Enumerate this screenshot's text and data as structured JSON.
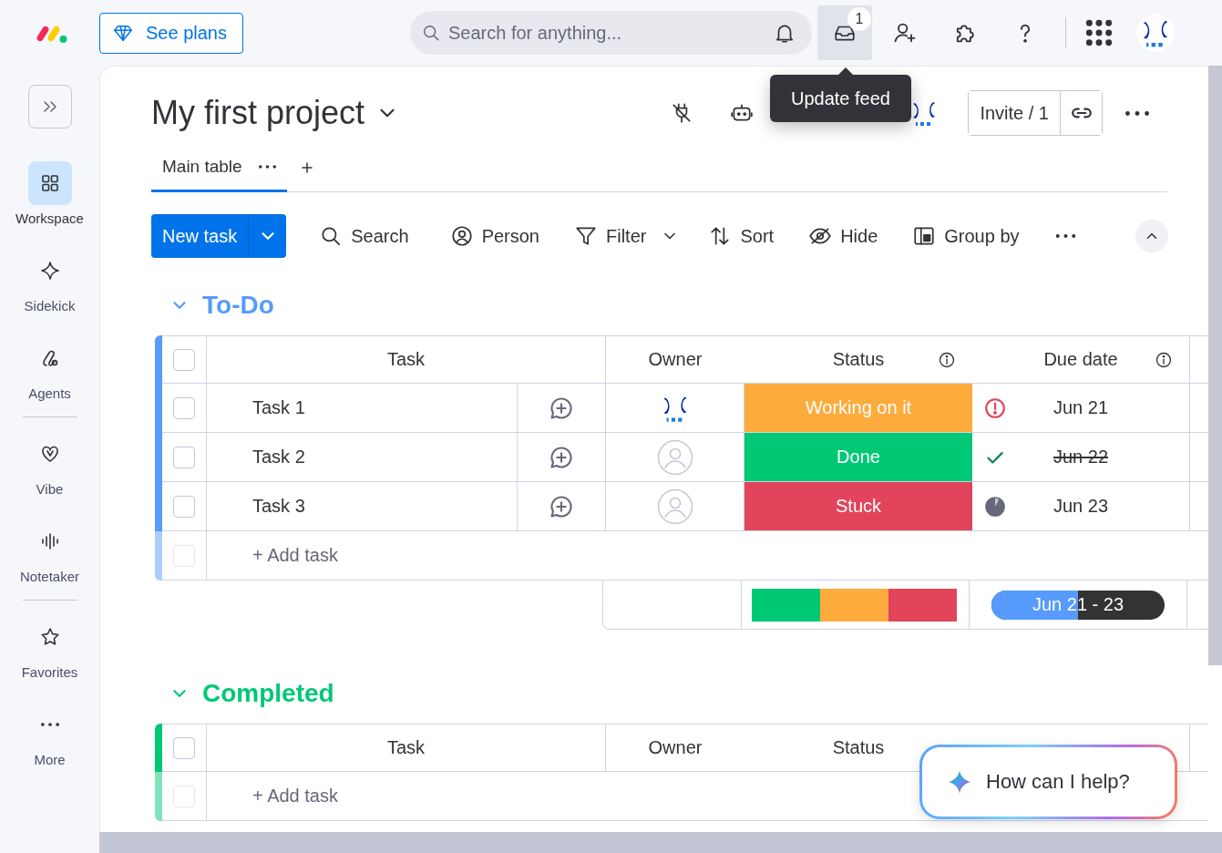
{
  "topbar": {
    "plans_button": "See plans",
    "search": {
      "placeholder": "Search for anything..."
    },
    "inbox_badge": "1"
  },
  "tooltip": "Update feed",
  "sidebar": {
    "sections": [
      {
        "items": [
          {
            "kind": "workspace",
            "label": "Workspace",
            "selected": true
          },
          {
            "kind": "sidekick",
            "label": "Sidekick",
            "selected": false
          },
          {
            "kind": "agents",
            "label": "Agents",
            "selected": false
          }
        ]
      },
      {
        "items": [
          {
            "kind": "vibe",
            "label": "Vibe",
            "selected": false
          },
          {
            "kind": "notetaker",
            "label": "Notetaker",
            "selected": false
          }
        ]
      },
      {
        "items": [
          {
            "kind": "favorites",
            "label": "Favorites",
            "selected": false
          },
          {
            "kind": "more",
            "label": "More",
            "selected": false
          }
        ]
      }
    ]
  },
  "board": {
    "title": "My first project",
    "invite": "Invite / 1",
    "tabs": [
      {
        "label": "Main table",
        "selected": true
      }
    ],
    "new_task": "New task",
    "toolbar": [
      {
        "kind": "search",
        "label": "Search"
      },
      {
        "kind": "person",
        "label": "Person"
      },
      {
        "kind": "filter",
        "label": "Filter"
      },
      {
        "kind": "sort",
        "label": "Sort"
      },
      {
        "kind": "hide",
        "label": "Hide"
      },
      {
        "kind": "group",
        "label": "Group by"
      }
    ],
    "groups": [
      {
        "name": "To-Do",
        "color": "#579bfc",
        "expanded": true,
        "all_checked": false,
        "columns": [
          {
            "label": "Task",
            "info": false
          },
          {
            "label": "Owner",
            "info": false
          },
          {
            "label": "Status",
            "info": true
          },
          {
            "label": "Due date",
            "info": true
          }
        ],
        "rows": [
          {
            "checked": false,
            "task": "Task 1",
            "assigned": true,
            "status": {
              "label": "Working on it",
              "color": "#fdab3d"
            },
            "due": {
              "date": "Jun 21",
              "kind": "overdue"
            }
          },
          {
            "checked": false,
            "task": "Task 2",
            "assigned": false,
            "status": {
              "label": "Done",
              "color": "#00c875"
            },
            "due": {
              "date": "Jun 22",
              "kind": "done"
            }
          },
          {
            "checked": false,
            "task": "Task 3",
            "assigned": false,
            "status": {
              "label": "Stuck",
              "color": "#e2445c"
            },
            "due": {
              "date": "Jun 23",
              "kind": "pending"
            }
          }
        ],
        "add_task": "+ Add task",
        "add_checkbox_disabled": true,
        "summary": {
          "status_segments": [
            {
              "color": "#00c875"
            },
            {
              "color": "#fdab3d"
            },
            {
              "color": "#e2445c"
            }
          ],
          "timeline": {
            "label": "Jun 21 - 23",
            "level": 0.5
          }
        }
      },
      {
        "name": "Completed",
        "color": "#00c875",
        "expanded": true,
        "all_checked": false,
        "columns": [
          {
            "label": "Task",
            "info": false
          },
          {
            "label": "Owner",
            "info": false
          },
          {
            "label": "Status",
            "info": false
          }
        ],
        "add_task": "+ Add task",
        "add_checkbox_disabled": true
      }
    ]
  },
  "help": {
    "label": "How can I help?"
  }
}
